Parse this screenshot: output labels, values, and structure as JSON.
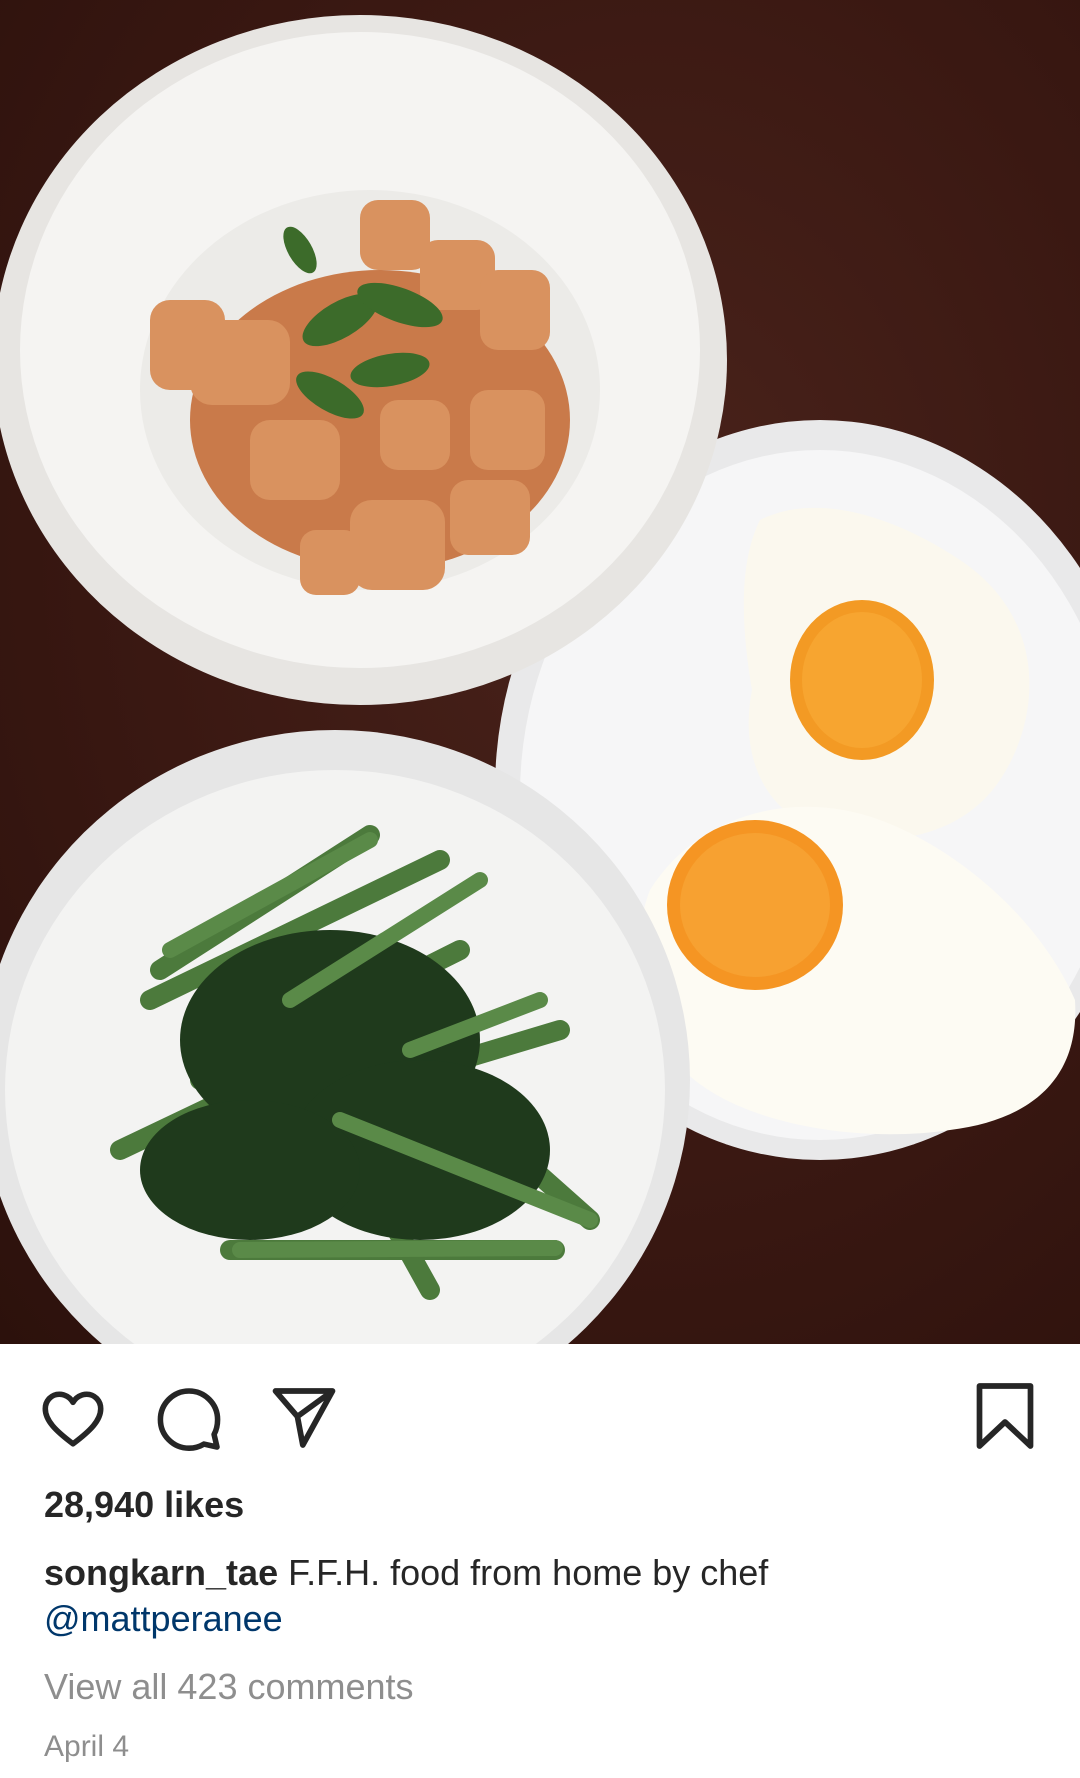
{
  "post": {
    "image_alt": "Three dishes: pork curry with basil, stir-fried morning glory, and two fried eggs",
    "likes_text": "28,940 likes",
    "caption": {
      "username": "songkarn_tae",
      "text": " F.F.H. food from home by chef ",
      "mention": "@mattperanee"
    },
    "view_comments_text": "View all 423 comments",
    "date_text": "April 4"
  },
  "actions": {
    "like_icon": "heart-outline",
    "comment_icon": "speech-bubble",
    "share_icon": "paper-plane",
    "save_icon": "bookmark-outline"
  },
  "colors": {
    "text": "#262626",
    "muted": "#8e8e8e",
    "mention": "#00376b"
  }
}
